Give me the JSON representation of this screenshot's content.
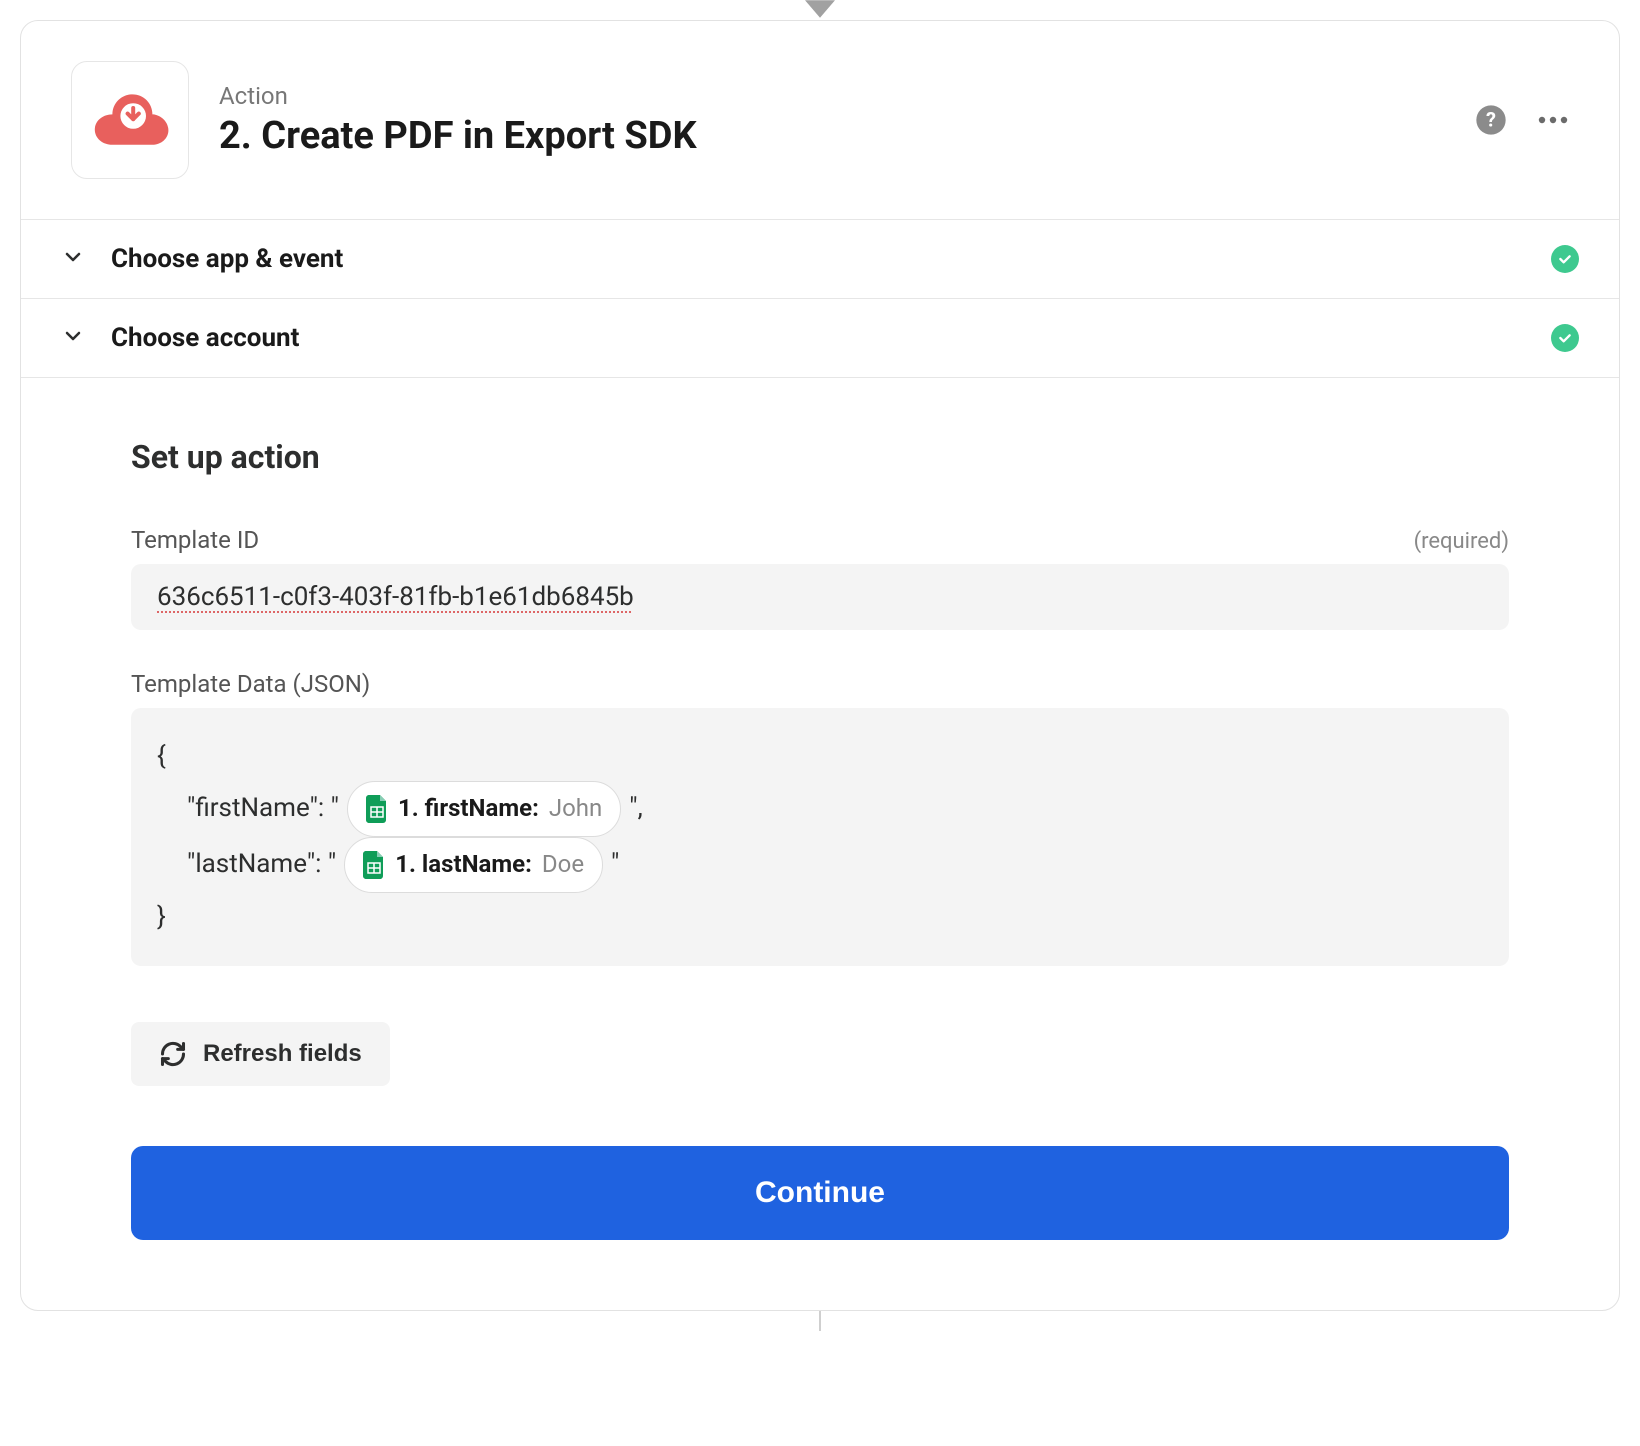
{
  "header": {
    "kicker": "Action",
    "title": "2. Create PDF in Export SDK"
  },
  "sections": {
    "choose_app_event": "Choose app & event",
    "choose_account": "Choose account",
    "set_up_action": "Set up action"
  },
  "fields": {
    "template_id": {
      "label": "Template ID",
      "required_text": "(required)",
      "value": "636c6511-c0f3-403f-81fb-b1e61db6845b"
    },
    "template_data": {
      "label": "Template Data (JSON)",
      "json_open": "{",
      "json_close": "}",
      "line1_key": "\"firstName\": \"",
      "line1_suffix": "\",",
      "line2_key": "\"lastName\": \"",
      "line2_suffix": "\"",
      "pill1_label": "1. firstName: ",
      "pill1_value": "John",
      "pill2_label": "1. lastName: ",
      "pill2_value": "Doe"
    }
  },
  "buttons": {
    "refresh": "Refresh fields",
    "continue": "Continue"
  }
}
